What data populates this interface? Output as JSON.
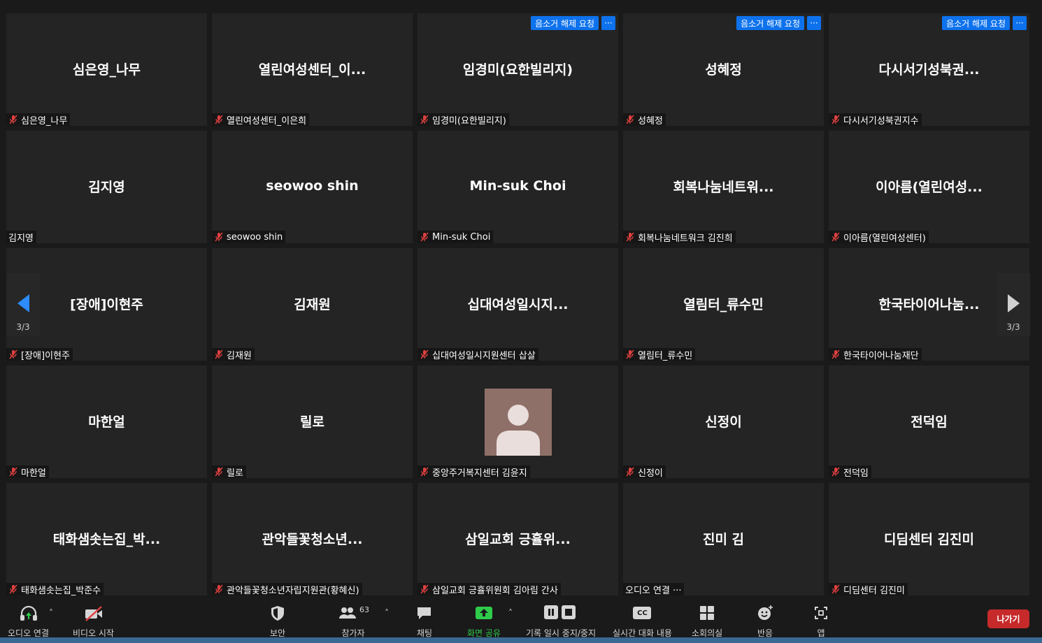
{
  "tiles": [
    {
      "name": "심은영_나무",
      "label": "심은영_나무",
      "muted": true,
      "unmute_request": false
    },
    {
      "name": "열린여성센터_이...",
      "label": "열린여성센터_이은희",
      "muted": true,
      "unmute_request": false
    },
    {
      "name": "임경미(요한빌리지)",
      "label": "임경미(요한빌리지)",
      "muted": true,
      "unmute_request": true
    },
    {
      "name": "성혜정",
      "label": "성혜정",
      "muted": true,
      "unmute_request": true
    },
    {
      "name": "다시서기성북권...",
      "label": "다시서기성북권지수",
      "muted": true,
      "unmute_request": true
    },
    {
      "name": "김지영",
      "label": "김지영",
      "muted": false,
      "unmute_request": false
    },
    {
      "name": "seowoo shin",
      "label": "seowoo shin",
      "muted": true,
      "unmute_request": false
    },
    {
      "name": "Min-suk Choi",
      "label": "Min-suk Choi",
      "muted": true,
      "unmute_request": false
    },
    {
      "name": "회복나눔네트워...",
      "label": "회복나눔네트워크 김진희",
      "muted": true,
      "unmute_request": false
    },
    {
      "name": "이아름(열린여성...",
      "label": "이아름(열린여성센터)",
      "muted": true,
      "unmute_request": false
    },
    {
      "name": "[장애]이현주",
      "label": "[장애]이현주",
      "muted": true,
      "unmute_request": false
    },
    {
      "name": "김재원",
      "label": "김재원",
      "muted": true,
      "unmute_request": false
    },
    {
      "name": "십대여성일시지...",
      "label": "십대여성일시지원센터 삽살",
      "muted": true,
      "unmute_request": false
    },
    {
      "name": "열림터_류수민",
      "label": "열림터_류수민",
      "muted": true,
      "unmute_request": false
    },
    {
      "name": "한국타이어나눔...",
      "label": "한국타이어나눔재단",
      "muted": true,
      "unmute_request": false
    },
    {
      "name": "마한얼",
      "label": "마한얼",
      "muted": true,
      "unmute_request": false
    },
    {
      "name": "릴로",
      "label": "릴로",
      "muted": true,
      "unmute_request": false
    },
    {
      "name": "",
      "label": "중앙주거복지센터 김윤지",
      "muted": true,
      "unmute_request": false,
      "avatar": true
    },
    {
      "name": "신정이",
      "label": "신정이",
      "muted": true,
      "unmute_request": false
    },
    {
      "name": "전덕임",
      "label": "전덕임",
      "muted": true,
      "unmute_request": false
    },
    {
      "name": "태화샘솟는집_박...",
      "label": "태화샘솟는집_박준수",
      "muted": true,
      "unmute_request": false
    },
    {
      "name": "관악들꽃청소년...",
      "label": "관악들꽃청소년자립지원관(황혜신)",
      "muted": true,
      "unmute_request": false
    },
    {
      "name": "삼일교회 긍휼위...",
      "label": "삼일교회 긍휼위원회 김아림 간사",
      "muted": true,
      "unmute_request": false
    },
    {
      "name": "진미 김",
      "label": "오디오 연결 ···",
      "muted": false,
      "unmute_request": false
    },
    {
      "name": "디딤센터 김진미",
      "label": "디딤센터 김진미",
      "muted": true,
      "unmute_request": false
    }
  ],
  "unmute_request_label": "음소거 해제 요청",
  "more_label": "···",
  "nav": {
    "prev_page": "3/3",
    "next_page": "3/3"
  },
  "toolbar": {
    "audio": "오디오 연결",
    "video": "비디오 시작",
    "security": "보안",
    "participants": "참가자",
    "participants_count": "63",
    "chat": "채팅",
    "share": "화면 공유",
    "record": "기록 일시 중지/중지",
    "captions": "실시간 대화 내용",
    "captions_icon_text": "CC",
    "breakout": "소회의실",
    "reactions": "반응",
    "apps": "앱",
    "leave": "나가기",
    "caret": "˄"
  },
  "colors": {
    "accent": "#0e72ed",
    "share": "#2fcc4b",
    "leave": "#c62a2a",
    "muted": "#e04040"
  }
}
